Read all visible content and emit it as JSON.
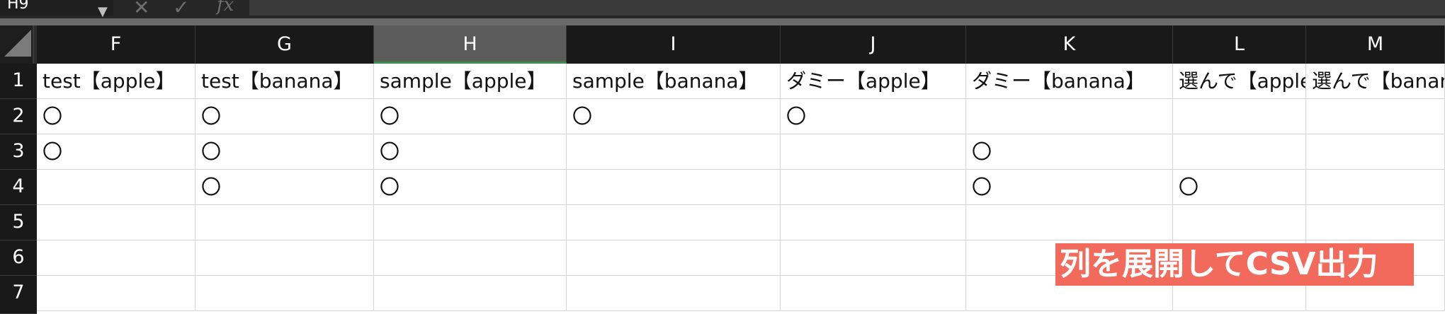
{
  "formula_bar": {
    "name_box": "H9",
    "cancel_icon": "✕",
    "enter_icon": "✓",
    "fx_label": "fx",
    "formula": ""
  },
  "columns": [
    "F",
    "G",
    "H",
    "I",
    "J",
    "K",
    "L",
    "M"
  ],
  "active_column": "H",
  "rows": [
    {
      "num": "1",
      "cells": [
        "test【apple】",
        "test【banana】",
        "sample【apple】",
        "sample【banana】",
        "ダミー【apple】",
        "ダミー【banana】",
        "選んで【apple】",
        "選んで【banana】"
      ]
    },
    {
      "num": "2",
      "cells": [
        "〇",
        "〇",
        "〇",
        "〇",
        "〇",
        "",
        "",
        ""
      ]
    },
    {
      "num": "3",
      "cells": [
        "〇",
        "〇",
        "〇",
        "",
        "",
        "〇",
        "",
        ""
      ]
    },
    {
      "num": "4",
      "cells": [
        "",
        "〇",
        "〇",
        "",
        "",
        "〇",
        "〇",
        ""
      ]
    },
    {
      "num": "5",
      "cells": [
        "",
        "",
        "",
        "",
        "",
        "",
        "",
        ""
      ]
    },
    {
      "num": "6",
      "cells": [
        "",
        "",
        "",
        "",
        "",
        "",
        "",
        ""
      ]
    },
    {
      "num": "7",
      "cells": [
        "",
        "",
        "",
        "",
        "",
        "",
        "",
        ""
      ]
    }
  ],
  "overlay": {
    "text": "列を展開してCSV出力",
    "color": "#f26a5c"
  }
}
